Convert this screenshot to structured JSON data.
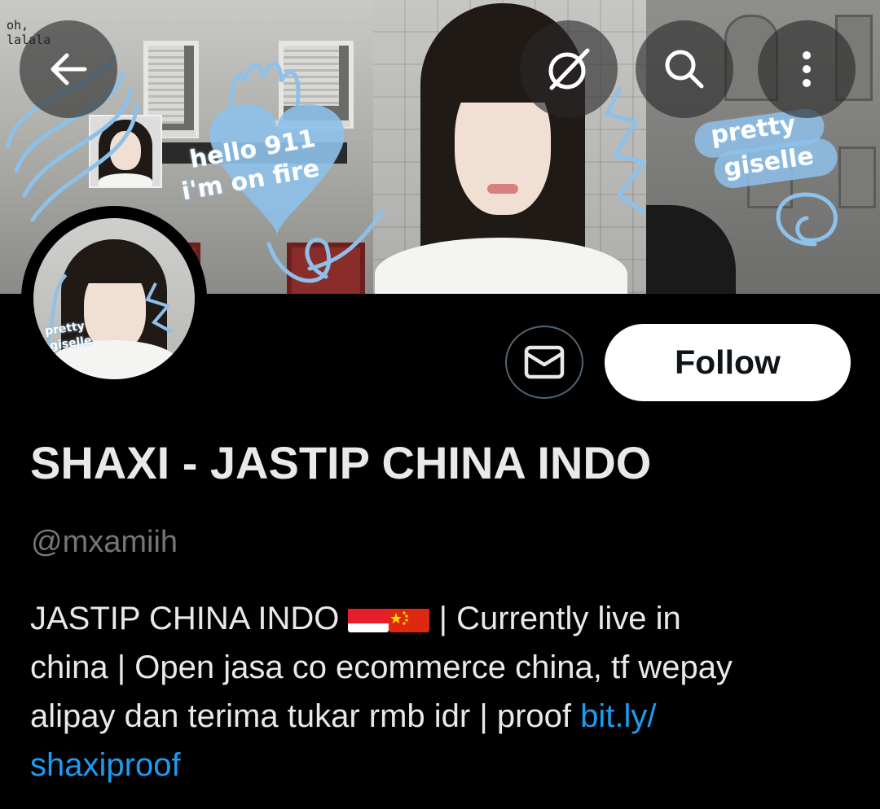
{
  "header": {
    "back_icon": "arrow-left-icon",
    "grok_icon": "grok-icon",
    "search_icon": "search-icon",
    "more_icon": "more-vertical-icon"
  },
  "banner": {
    "corner_text_line1": "oh,",
    "corner_text_line2": "lalala",
    "doodle_text_1": "hello 911",
    "doodle_text_2": "i'm on fire",
    "doodle_text_3": "pretty",
    "doodle_text_4": "giselle"
  },
  "profile": {
    "avatar_text_1": "pretty",
    "avatar_text_2": "giselle",
    "message_icon": "envelope-icon",
    "follow_label": "Follow",
    "display_name": "SHAXI - JASTIP CHINA INDO",
    "handle": "@mxamiih",
    "bio": {
      "line1_text": "JASTIP CHINA INDO ",
      "flag_1": "indonesia-flag-icon",
      "flag_2": "china-flag-icon",
      "line1_rest": " | Currently live in",
      "line2": "china | Open jasa co ecommerce china, tf wepay",
      "line3": "alipay dan terima tukar rmb idr | proof ",
      "link_part1": "bit.ly/",
      "link_part2": "shaxiproof"
    }
  },
  "colors": {
    "background": "#000000",
    "text_primary": "#e7e9ea",
    "text_secondary": "#71767b",
    "link": "#1d9bf0",
    "follow_bg": "#ffffff",
    "doodle_blue": "#8ec1ea"
  }
}
